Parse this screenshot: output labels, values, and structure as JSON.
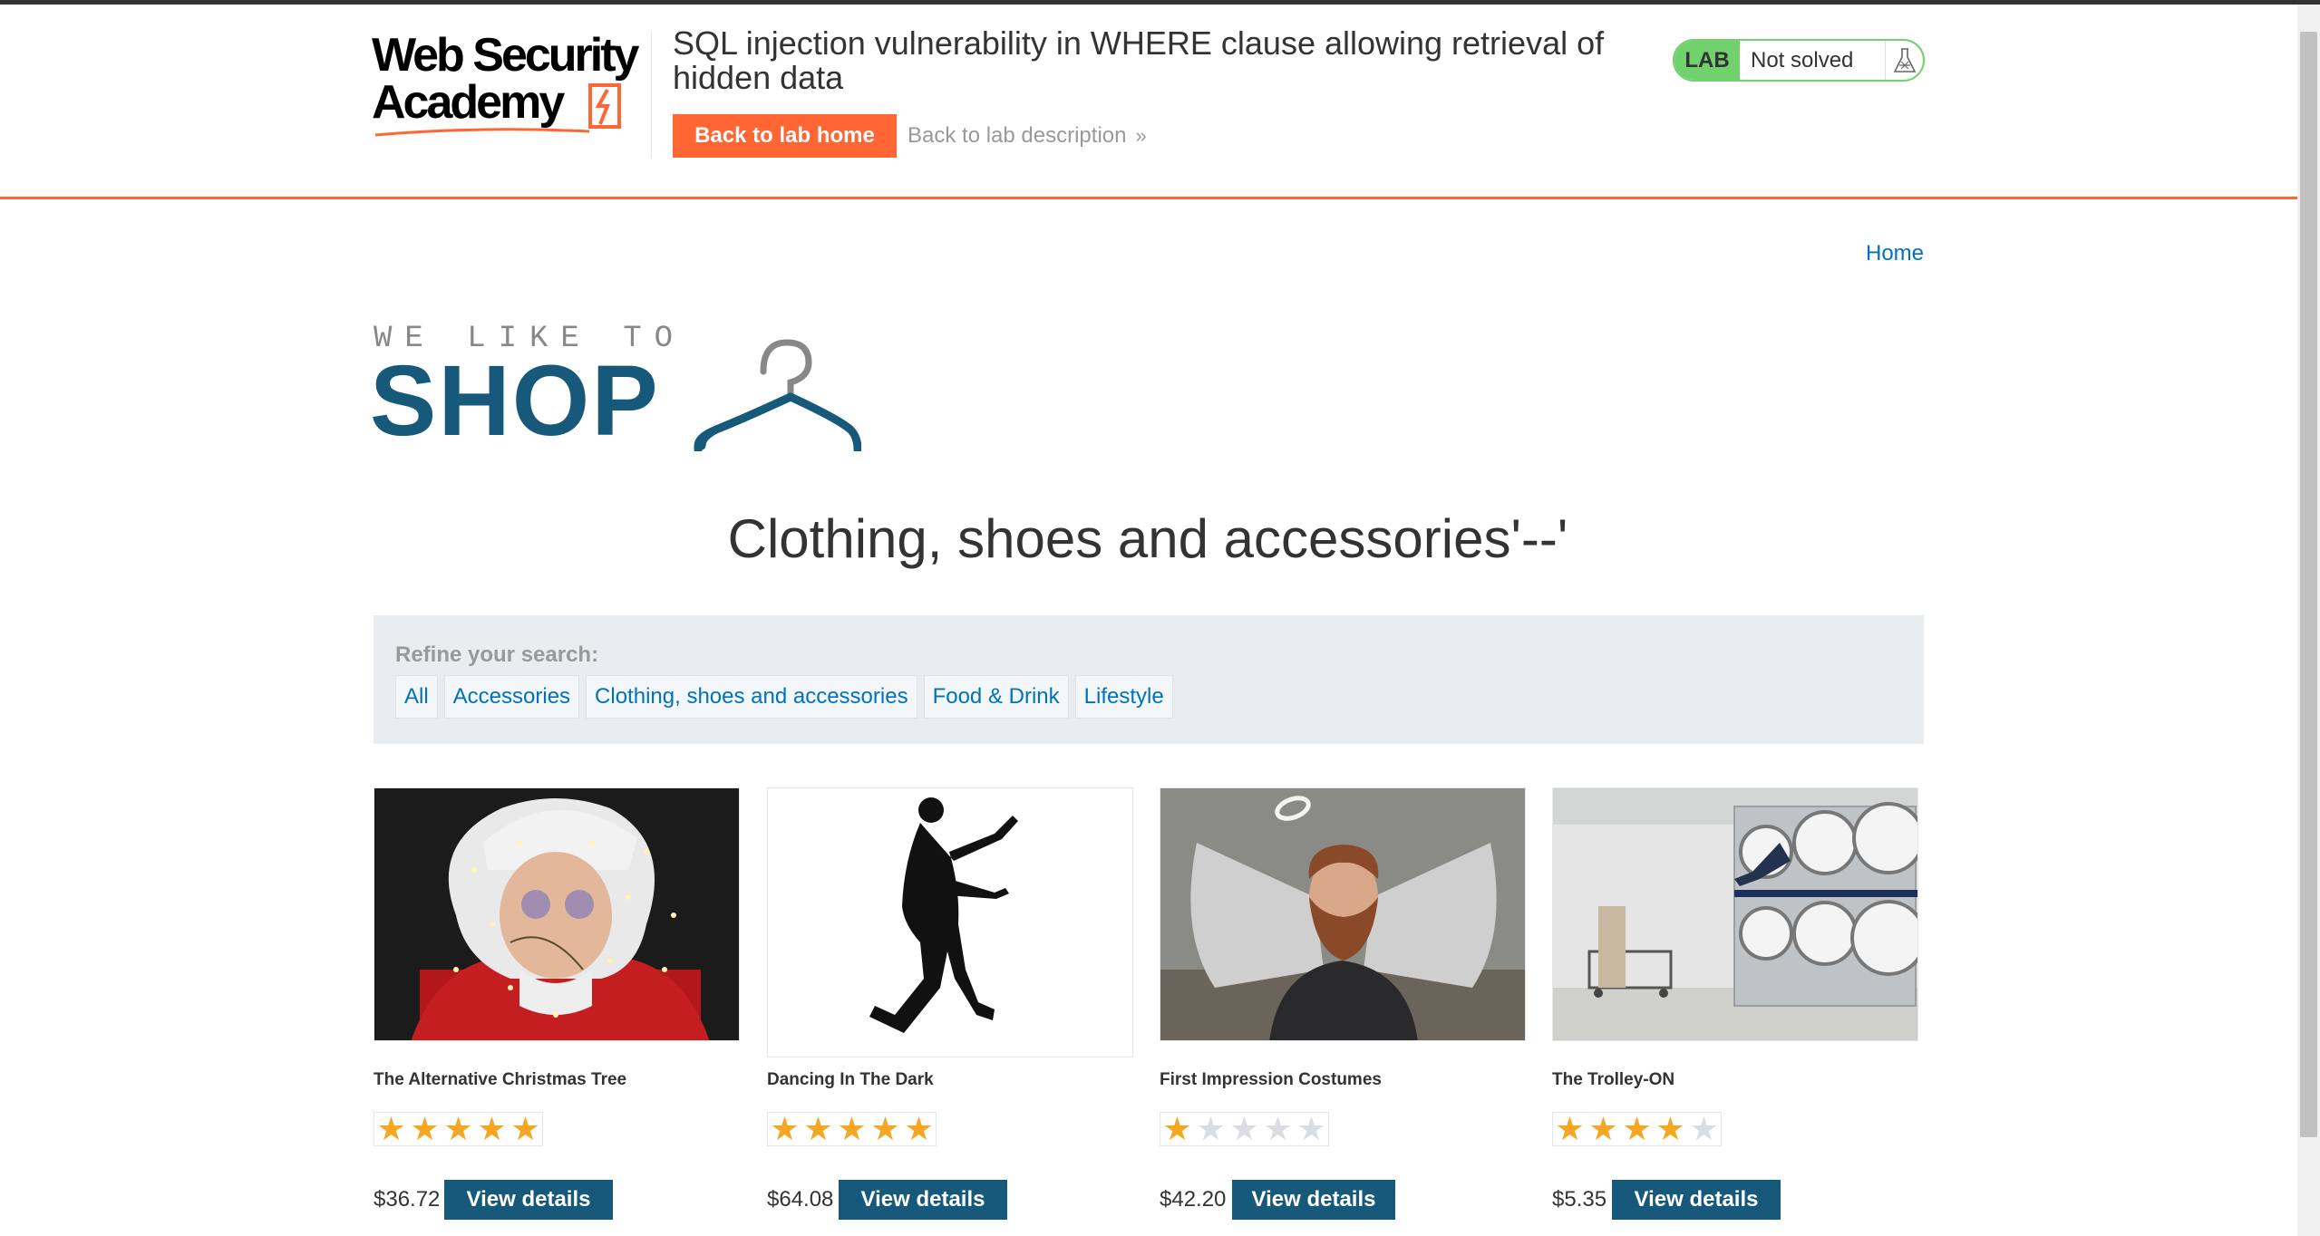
{
  "header": {
    "logo_line1": "Web Security",
    "logo_line2": "Academy",
    "lab_title": "SQL injection vulnerability in WHERE clause allowing retrieval of hidden data",
    "back_home": "Back to lab home",
    "back_description": "Back to lab description",
    "status_badge": "LAB",
    "status_text": "Not solved",
    "accent_color": "#ff6633",
    "status_color": "#70d16d"
  },
  "nav": {
    "home": "Home"
  },
  "shop": {
    "tagline": "WE LIKE TO",
    "name": "SHOP",
    "brand_color": "#16597a"
  },
  "page": {
    "heading": "Clothing, shoes and accessories'--'"
  },
  "filters": {
    "label": "Refine your search:",
    "links": [
      "All",
      "Accessories",
      "Clothing, shoes and accessories",
      "Food & Drink",
      "Lifestyle"
    ]
  },
  "products": [
    {
      "name": "The Alternative Christmas Tree",
      "rating": 5,
      "price": "$36.72",
      "button": "View details",
      "image_icon": "santa-photo"
    },
    {
      "name": "Dancing In The Dark",
      "rating": 5,
      "price": "$64.08",
      "button": "View details",
      "image_icon": "dancer-silhouette"
    },
    {
      "name": "First Impression Costumes",
      "rating": 1,
      "price": "$42.20",
      "button": "View details",
      "image_icon": "angel-man-photo"
    },
    {
      "name": "The Trolley-ON",
      "rating": 4,
      "price": "$5.35",
      "button": "View details",
      "image_icon": "laundromat-photo"
    }
  ]
}
